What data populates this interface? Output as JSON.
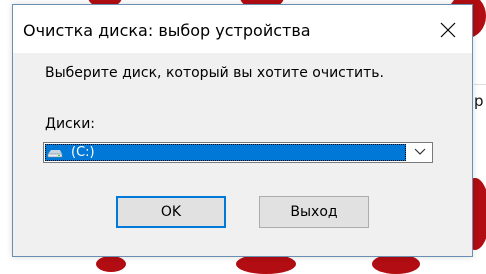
{
  "window": {
    "title": "Очистка диска: выбор устройства",
    "close_icon": "close-icon"
  },
  "dialog": {
    "prompt": "Выберите диск, который вы хотите очистить.",
    "drives_label": "Диски:",
    "drive_select": {
      "selected": "(C:)",
      "icon": "drive-icon",
      "arrow_icon": "chevron-down-icon"
    },
    "ok_label": "OK",
    "exit_label": "Выход"
  },
  "background": {
    "partial_text": "р"
  },
  "colors": {
    "accent": "#0078d7",
    "dialog_bg": "#f0f0f0",
    "title_bg": "#ffffff",
    "background_decor": "#b10d12"
  }
}
